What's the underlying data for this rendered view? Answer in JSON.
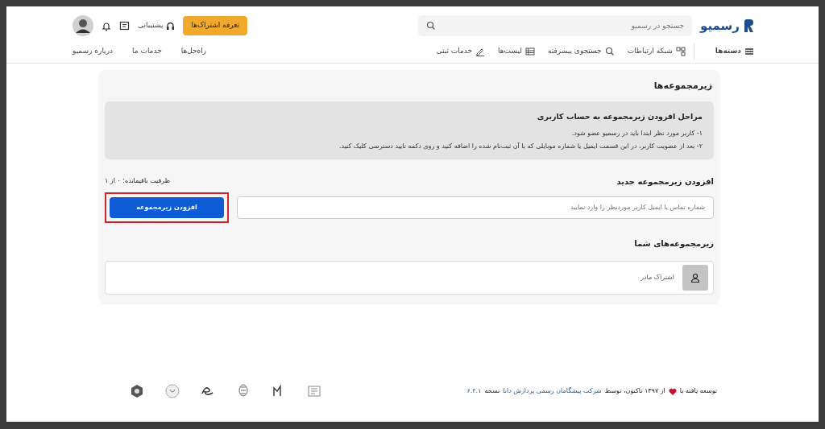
{
  "header": {
    "logo": "رسمیو",
    "search": {
      "placeholder": "جستجو در رسمیو"
    },
    "pricing_button": "تعرفه اشتراک‌ها",
    "support": "پشتیبانی"
  },
  "nav": {
    "items": [
      {
        "label": "دسته‌ها",
        "kind": "menu"
      },
      {
        "label": "شبکه ارتباطات",
        "kind": "network"
      },
      {
        "label": "جستجوی پیشرفته",
        "kind": "search"
      },
      {
        "label": "لیست‌ها",
        "kind": "list"
      },
      {
        "label": "خدمات ثبتی",
        "kind": "pen"
      }
    ],
    "links": [
      "راه‌حل‌ها",
      "خدمات ما",
      "درباره رسمیو"
    ]
  },
  "page": {
    "title": "زیرمجموعه‌ها",
    "info": {
      "title": "مراحل افزودن زیرمجموعه به حساب کاربری",
      "steps": [
        "۱- کاربر مورد نظر ابتدا باید در رسمیو عضو شود.",
        "۲- بعد از عضویت کاربر، در این قسمت ایمیل یا شماره موبایلی که با آن ثبت‌نام شده را اضافه کنید و روی دکمه تایید دسترسی کلیک کنید."
      ]
    },
    "add": {
      "title": "افزودن زیرمجموعه جدید",
      "capacity": "ظرفیت باقیمانده: ۰ از ۱",
      "input": {
        "placeholder": "شماره تماس یا ایمیل کاربر موردنظر را وارد نمایید"
      },
      "button": {
        "label": "افزودن زیرمجموعه",
        "highlighted": true
      }
    },
    "list": {
      "title": "زیرمجموعه‌های شما",
      "items": [
        {
          "label": "اشتراک مادر"
        }
      ]
    }
  },
  "footer": {
    "text_1": "توسعه یافته با",
    "text_2": "از ۱۳۹۷ تاکنون، توسط",
    "company_link": "شرکت پیشگامان رسمی پردازش دانا",
    "text_3": "نسخه",
    "version": "۶.۴.۱"
  }
}
